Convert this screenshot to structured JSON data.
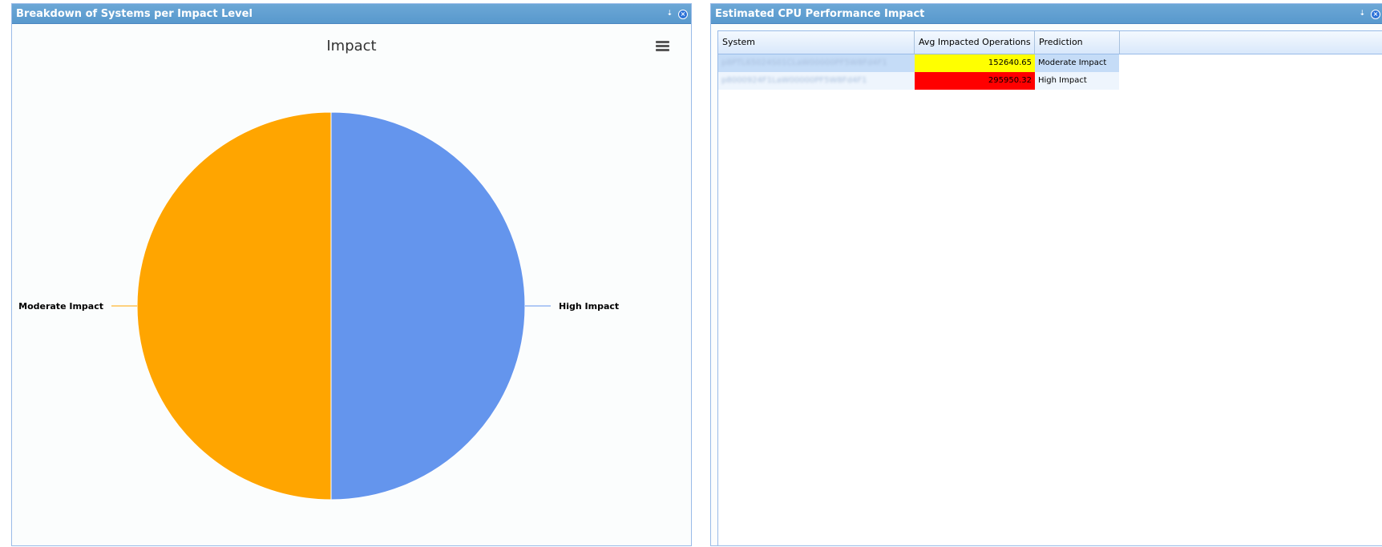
{
  "left_panel": {
    "title": "Breakdown of Systems per Impact Level",
    "tools": {
      "collapse_icon": "arrow-down-icon",
      "close_icon": "close-circle-icon",
      "collapse_glyph": "⇣",
      "close_glyph": "×"
    }
  },
  "right_panel": {
    "title": "Estimated CPU Performance Impact",
    "tools": {
      "collapse_icon": "arrow-down-icon",
      "close_icon": "close-circle-icon",
      "collapse_glyph": "⇣",
      "close_glyph": "×"
    }
  },
  "chart_menu_icon": "hamburger-menu-icon",
  "chart_data": {
    "type": "pie",
    "title": "Impact",
    "slices": [
      {
        "label": "High Impact",
        "value": 1,
        "color": "#6495ed"
      },
      {
        "label": "Moderate Impact",
        "value": 1,
        "color": "#ffa500"
      }
    ]
  },
  "grid": {
    "columns": [
      "System",
      "Avg Impacted Operations",
      "Prediction"
    ],
    "rows": [
      {
        "system": "p8PTL65024S01CLaW00000PF5W8Fd4F1",
        "avg_ops": "152640.65",
        "prediction": "Moderate Impact",
        "ops_color": "#ffff00"
      },
      {
        "system": "p8000924F1LaW00000PF5W8Fd4F1",
        "avg_ops": "295950.32",
        "prediction": "High Impact",
        "ops_color": "#ff0000"
      }
    ]
  }
}
